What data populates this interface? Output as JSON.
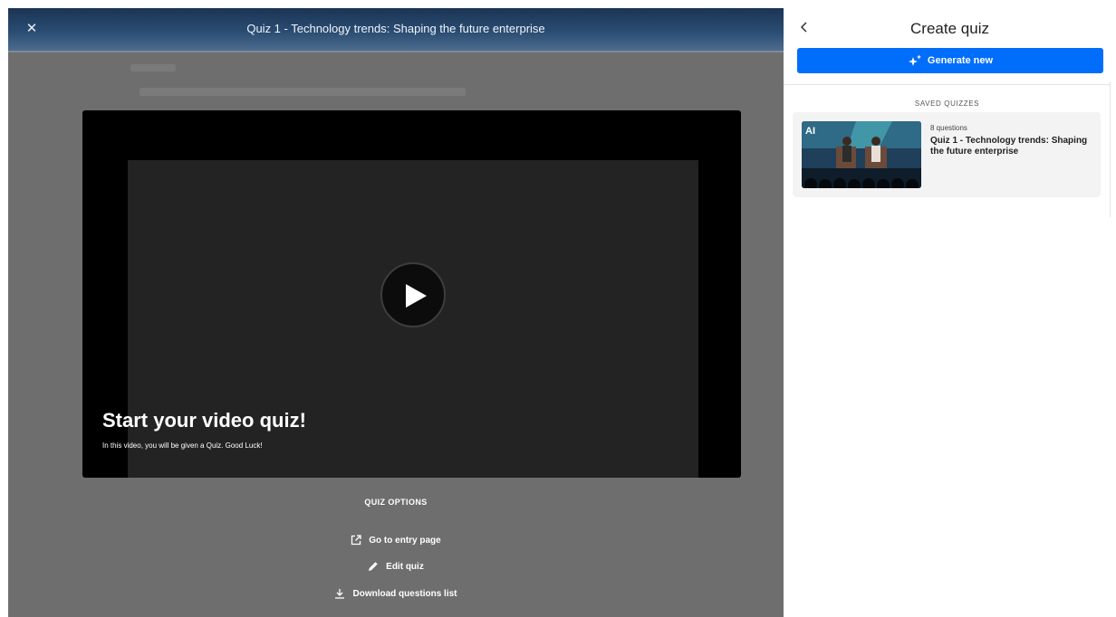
{
  "overlay": {
    "title": "Quiz 1 - Technology trends: Shaping the future enterprise",
    "close_icon": "close-icon"
  },
  "video": {
    "heading": "Start your video quiz!",
    "subtitle": "In this video, you will be given a Quiz. Good Luck!",
    "play_icon": "play-icon"
  },
  "quiz_options": {
    "title": "QUIZ OPTIONS",
    "items": [
      {
        "label": "Go to entry page",
        "icon": "external-link-icon"
      },
      {
        "label": "Edit quiz",
        "icon": "pencil-icon"
      },
      {
        "label": "Download questions list",
        "icon": "download-icon"
      }
    ]
  },
  "panel": {
    "title": "Create quiz",
    "back_icon": "chevron-left-icon",
    "generate_label": "Generate new",
    "generate_icon": "sparkle-icon",
    "saved_title": "SAVED QUIZZES",
    "saved": [
      {
        "count": "8 questions",
        "title": "Quiz 1 - Technology trends: Shaping the future enterprise",
        "thumb_text": "AI"
      }
    ]
  },
  "colors": {
    "accent": "#006efa",
    "overlay_bg": "#6e6e6e",
    "header_bg": "#1b3454"
  }
}
